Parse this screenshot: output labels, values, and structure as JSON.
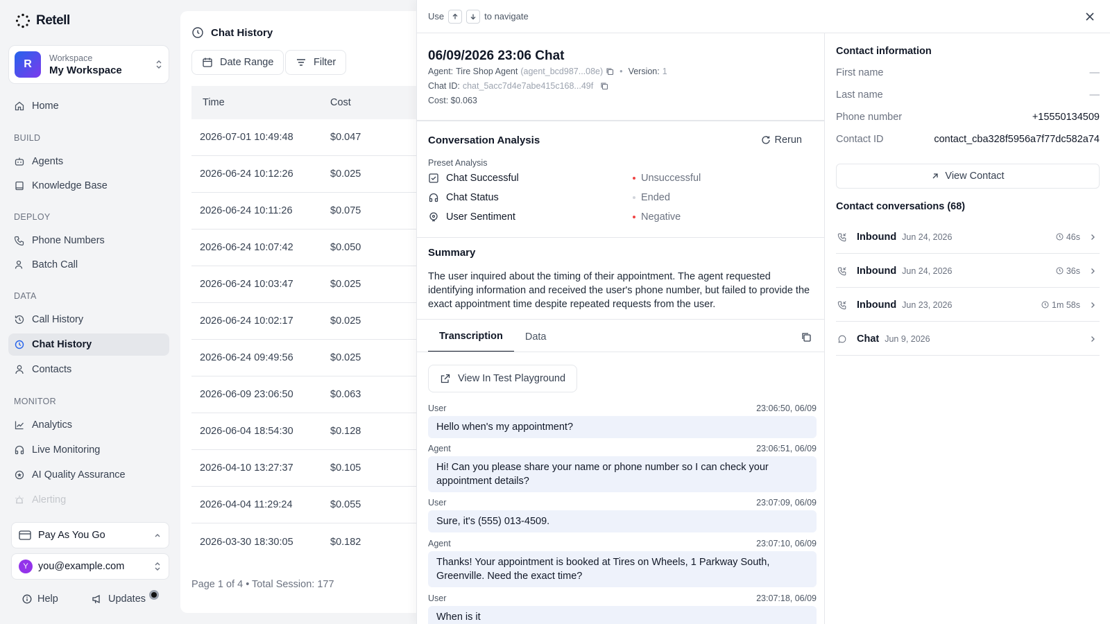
{
  "brand": {
    "name": "Retell"
  },
  "workspace": {
    "avatar": "R",
    "label": "Workspace",
    "name": "My Workspace"
  },
  "nav": {
    "home": "Home",
    "build_label": "BUILD",
    "agents": "Agents",
    "knowledge_base": "Knowledge Base",
    "deploy_label": "DEPLOY",
    "phone_numbers": "Phone Numbers",
    "batch_call": "Batch Call",
    "data_label": "DATA",
    "call_history": "Call History",
    "chat_history": "Chat History",
    "contacts": "Contacts",
    "monitor_label": "MONITOR",
    "analytics": "Analytics",
    "live_monitoring": "Live Monitoring",
    "ai_quality": "AI Quality Assurance",
    "alerting": "Alerting"
  },
  "plan": {
    "label": "Pay As You Go"
  },
  "user": {
    "avatar": "Y",
    "email": "you@example.com"
  },
  "footer": {
    "help": "Help",
    "updates": "Updates"
  },
  "list": {
    "title": "Chat History",
    "date_range": "Date Range",
    "filter": "Filter",
    "columns": [
      "Time",
      "Cost"
    ],
    "rows": [
      {
        "time": "2026-07-01 10:49:48",
        "cost": "$0.047"
      },
      {
        "time": "2026-06-24 10:12:26",
        "cost": "$0.025"
      },
      {
        "time": "2026-06-24 10:11:26",
        "cost": "$0.075"
      },
      {
        "time": "2026-06-24 10:07:42",
        "cost": "$0.050"
      },
      {
        "time": "2026-06-24 10:03:47",
        "cost": "$0.025"
      },
      {
        "time": "2026-06-24 10:02:17",
        "cost": "$0.025"
      },
      {
        "time": "2026-06-24 09:49:56",
        "cost": "$0.025"
      },
      {
        "time": "2026-06-09 23:06:50",
        "cost": "$0.063"
      },
      {
        "time": "2026-06-04 18:54:30",
        "cost": "$0.128"
      },
      {
        "time": "2026-04-10 13:27:37",
        "cost": "$0.105"
      },
      {
        "time": "2026-04-04 11:29:24",
        "cost": "$0.055"
      },
      {
        "time": "2026-03-30 18:30:05",
        "cost": "$0.182"
      }
    ],
    "pager": "Page 1 of 4 • Total Session: 177"
  },
  "topbar": {
    "use": "Use",
    "navigate": "to navigate"
  },
  "detail": {
    "title": "06/09/2026 23:06 Chat",
    "agent_prefix": "Agent:",
    "agent_name": "Tire Shop Agent",
    "agent_id": "(agent_bcd987...08e)",
    "version_label": "Version:",
    "version": "1",
    "chat_id_label": "Chat ID:",
    "chat_id": "chat_5acc7d4e7abe415c168...49f",
    "cost": "Cost: $0.063",
    "analysis_title": "Conversation Analysis",
    "rerun": "Rerun",
    "preset_label": "Preset Analysis",
    "analysis": [
      {
        "key": "Chat Successful",
        "value": "Unsuccessful",
        "color": "#ef4444"
      },
      {
        "key": "Chat Status",
        "value": "Ended",
        "color": "#d1d5db"
      },
      {
        "key": "User Sentiment",
        "value": "Negative",
        "color": "#ef4444"
      }
    ],
    "summary_title": "Summary",
    "summary": "The user inquired about the timing of their appointment. The agent requested identifying information and received the user's phone number, but failed to provide the exact appointment time despite repeated requests from the user.",
    "tabs": [
      "Transcription",
      "Data"
    ],
    "playground": "View In Test Playground",
    "messages": [
      {
        "role": "User",
        "time": "23:06:50, 06/09",
        "text": "Hello when's my appointment?"
      },
      {
        "role": "Agent",
        "time": "23:06:51, 06/09",
        "text": "Hi! Can you please share your name or phone number so I can check your appointment details?"
      },
      {
        "role": "User",
        "time": "23:07:09, 06/09",
        "text": "Sure, it's (555) 013-4509."
      },
      {
        "role": "Agent",
        "time": "23:07:10, 06/09",
        "text": "Thanks! Your appointment is booked at Tires on Wheels, 1 Parkway South, Greenville. Need the exact time?"
      },
      {
        "role": "User",
        "time": "23:07:18, 06/09",
        "text": "When is it"
      }
    ]
  },
  "contact": {
    "title": "Contact information",
    "first_name_label": "First name",
    "first_name": "—",
    "last_name_label": "Last name",
    "last_name": "—",
    "phone_label": "Phone number",
    "phone": "+15550134509",
    "id_label": "Contact ID",
    "id": "contact_cba328f5956a7f77dc582a74",
    "view_contact": "View Contact",
    "conversations_title": "Contact conversations (68)",
    "conversations": [
      {
        "type": "Inbound",
        "date": "Jun 24, 2026",
        "duration": "46s",
        "icon": "phone-icon"
      },
      {
        "type": "Inbound",
        "date": "Jun 24, 2026",
        "duration": "36s",
        "icon": "phone-icon"
      },
      {
        "type": "Inbound",
        "date": "Jun 23, 2026",
        "duration": "1m 58s",
        "icon": "phone-icon"
      },
      {
        "type": "Chat",
        "date": "Jun 9, 2026",
        "duration": "",
        "icon": "chat-bubble-icon"
      }
    ]
  }
}
